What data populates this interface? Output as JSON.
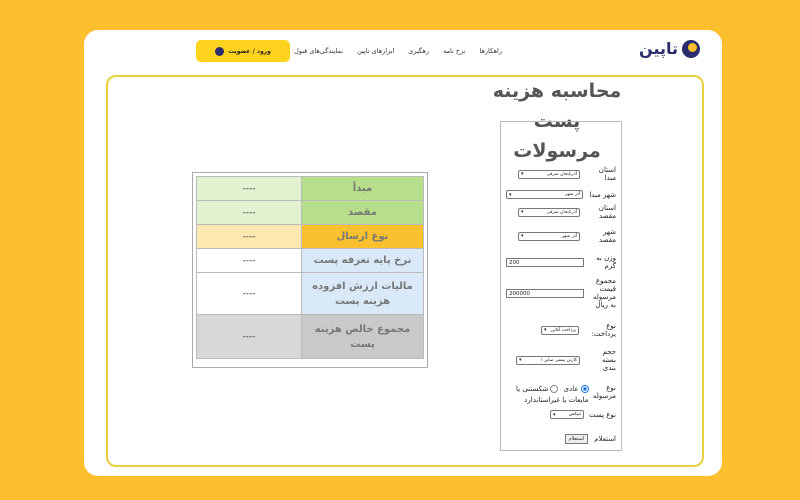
{
  "header": {
    "logo_text": "تاپین",
    "nav": [
      "راهکارها",
      "نرخ نامه",
      "رهگیری",
      "ابزارهای تاپین",
      "نمایندگی‌های قبول"
    ],
    "login_label": "ورود / عضویت"
  },
  "calculator": {
    "title": "محاسبه هزینه پست مرسولات",
    "fields": {
      "origin_province": {
        "label": "استان مبدا",
        "value": "آذربایجان شرقی"
      },
      "origin_city": {
        "label": "شهر مبدا",
        "value": "آذر شهر"
      },
      "dest_province": {
        "label": "استان مقصد",
        "value": "آذربایجان شرقی"
      },
      "dest_city": {
        "label": "شهر مقصد",
        "value": "آذر شهر"
      },
      "weight": {
        "label": "وزن به گرم",
        "value": "200"
      },
      "value_total": {
        "label": "مجموع قیمت مرسوله به ریال",
        "value": "200000"
      },
      "payment": {
        "label": "نوع پرداخت:",
        "value": "پرداخت آنلاین"
      },
      "packaging": {
        "label": "حجم بسته بندی",
        "value": "کارتن پستی سایز ۱"
      },
      "parcel_type": {
        "label": "نوع مرسوله",
        "option_normal": "عادی",
        "option_fragile": "شکستنی یا مایعات یا غیراستاندارد",
        "selected": "عادی"
      },
      "post_type": {
        "label": "نوع پست",
        "value": "تیپکس"
      }
    },
    "submit_label": "استعلام"
  },
  "results": {
    "rows": [
      {
        "label": "مبدأ",
        "value": "----",
        "color": "#b7de8a",
        "vcolor": "#e2f1cf"
      },
      {
        "label": "مقصد",
        "value": "----",
        "color": "#b7de8a",
        "vcolor": "#e2f1cf"
      },
      {
        "label": "نوع ارسال",
        "value": "----",
        "color": "#fbc02d",
        "vcolor": "#fde9b0"
      },
      {
        "label": "نرخ پایه تعرفه پست",
        "value": "----",
        "color": "#d9e9f8",
        "vcolor": "#ffffff"
      },
      {
        "label": "مالیات ارزش افزوده هزینه پست",
        "value": "----",
        "color": "#d9e9f8",
        "vcolor": "#ffffff"
      },
      {
        "label": "مجموع خالص هزینه پست",
        "value": "----",
        "color": "#c9c9c9",
        "vcolor": "#d8d8d8"
      }
    ]
  }
}
